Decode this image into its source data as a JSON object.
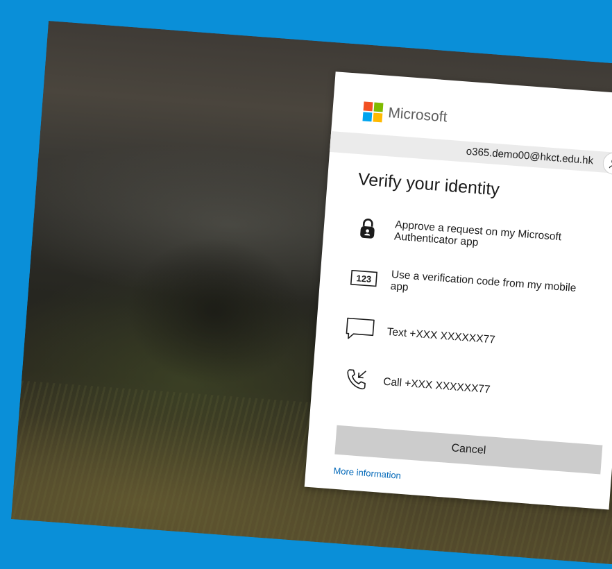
{
  "brand": {
    "name": "Microsoft",
    "logo_colors": [
      "#f25022",
      "#7fba00",
      "#00a4ef",
      "#ffb900"
    ]
  },
  "account": {
    "email": "o365.demo00@hkct.edu.hk",
    "icon": "account-switch-icon"
  },
  "dialog": {
    "title": "Verify your identity",
    "options": [
      {
        "icon": "authenticator-lock-icon",
        "label": "Approve a request on my Microsoft Authenticator app"
      },
      {
        "icon": "verification-code-icon",
        "label": "Use a verification code from my mobile app",
        "icon_text": "123"
      },
      {
        "icon": "sms-message-icon",
        "label": "Text +XXX XXXXXX77"
      },
      {
        "icon": "phone-call-icon",
        "label": "Call +XXX XXXXXX77"
      }
    ],
    "cancel_label": "Cancel",
    "more_info_label": "More information"
  },
  "colors": {
    "frame_background": "#0a8fd8",
    "button_gray": "#cccccc",
    "link_blue": "#0067b8"
  }
}
